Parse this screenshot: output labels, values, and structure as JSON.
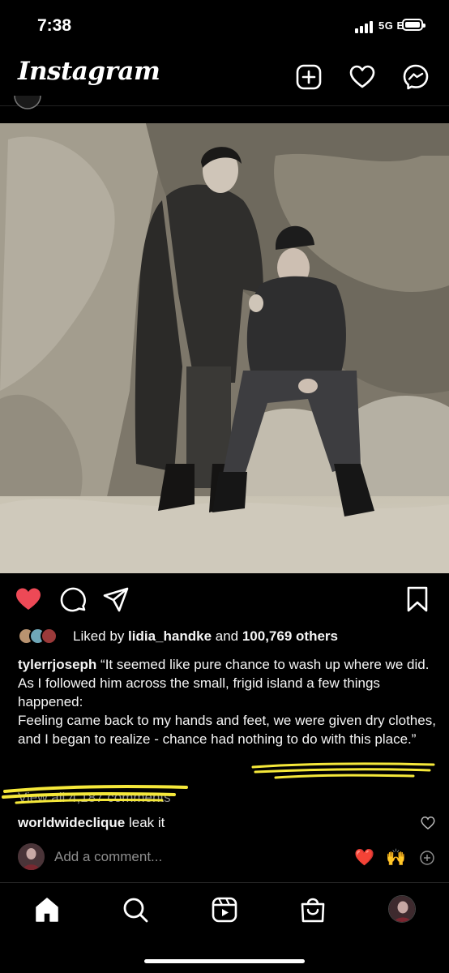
{
  "status_bar": {
    "time": "7:38",
    "network": "5G E"
  },
  "header": {
    "app_name": "Instagram"
  },
  "post": {
    "liked_by_prefix": "Liked by ",
    "liked_by_user": "lidia_handke",
    "liked_by_middle": " and ",
    "liked_by_count": "100,769 others",
    "caption": {
      "username": "tylerrjoseph",
      "line1": " “It seemed like pure chance to wash up where we did.",
      "line2": "As I followed him across the small, frigid island a few things happened:",
      "line3": "Feeling came back to my hands and feet, we were given dry clothes, and I began to realize - chance had nothing to do with this place.”"
    },
    "view_all_comments": "View all 4,187 comments",
    "comment": {
      "username": "worldwideclique",
      "text": " leak it"
    },
    "add_comment_placeholder": "Add a comment...",
    "quick_emojis": [
      "❤️",
      "🙌"
    ]
  },
  "colors": {
    "background": "#000000",
    "like_red": "#ed4956",
    "annotation_yellow": "#f5e83a",
    "secondary_text": "#8e8e8e"
  },
  "icons": {
    "header": [
      "add-post-icon",
      "activity-heart-icon",
      "messenger-icon"
    ],
    "actions": [
      "like-heart-icon",
      "comment-icon",
      "share-icon",
      "bookmark-icon"
    ],
    "nav": [
      "home-icon",
      "search-icon",
      "reels-icon",
      "shop-icon",
      "profile-avatar"
    ]
  }
}
